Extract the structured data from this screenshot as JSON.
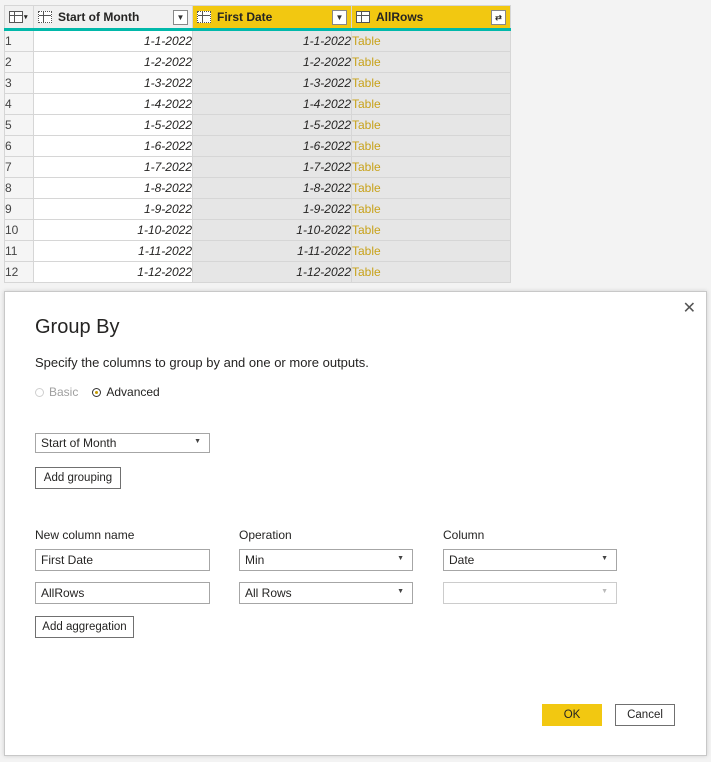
{
  "grid": {
    "columns": [
      {
        "label": "Start of Month",
        "icon": "calendar-grid-icon",
        "control": "filter-dropdown"
      },
      {
        "label": "First Date",
        "icon": "calendar-grid-icon",
        "control": "filter-dropdown",
        "selected": true
      },
      {
        "label": "AllRows",
        "icon": "table-icon",
        "control": "expand-icon",
        "selected": true
      }
    ],
    "rows": [
      {
        "n": "1",
        "a": "1-1-2022",
        "b": "1-1-2022",
        "c": "Table"
      },
      {
        "n": "2",
        "a": "1-2-2022",
        "b": "1-2-2022",
        "c": "Table"
      },
      {
        "n": "3",
        "a": "1-3-2022",
        "b": "1-3-2022",
        "c": "Table"
      },
      {
        "n": "4",
        "a": "1-4-2022",
        "b": "1-4-2022",
        "c": "Table"
      },
      {
        "n": "5",
        "a": "1-5-2022",
        "b": "1-5-2022",
        "c": "Table"
      },
      {
        "n": "6",
        "a": "1-6-2022",
        "b": "1-6-2022",
        "c": "Table"
      },
      {
        "n": "7",
        "a": "1-7-2022",
        "b": "1-7-2022",
        "c": "Table"
      },
      {
        "n": "8",
        "a": "1-8-2022",
        "b": "1-8-2022",
        "c": "Table"
      },
      {
        "n": "9",
        "a": "1-9-2022",
        "b": "1-9-2022",
        "c": "Table"
      },
      {
        "n": "10",
        "a": "1-10-2022",
        "b": "1-10-2022",
        "c": "Table"
      },
      {
        "n": "11",
        "a": "1-11-2022",
        "b": "1-11-2022",
        "c": "Table"
      },
      {
        "n": "12",
        "a": "1-12-2022",
        "b": "1-12-2022",
        "c": "Table"
      }
    ]
  },
  "dialog": {
    "title": "Group By",
    "close_icon": "close-icon",
    "description": "Specify the columns to group by and one or more outputs.",
    "mode_basic": "Basic",
    "mode_advanced": "Advanced",
    "selected_mode": "Advanced",
    "grouping_column": "Start of Month",
    "add_grouping_label": "Add grouping",
    "headers": {
      "new_column_name": "New column name",
      "operation": "Operation",
      "column": "Column"
    },
    "aggregations": [
      {
        "name": "First Date",
        "operation": "Min",
        "column": "Date"
      },
      {
        "name": "AllRows",
        "operation": "All Rows",
        "column": ""
      }
    ],
    "add_aggregation_label": "Add aggregation",
    "ok_label": "OK",
    "cancel_label": "Cancel"
  },
  "colors": {
    "accent": "#f2c811",
    "header_underline": "#01b8aa",
    "table_link": "#c8a21a"
  }
}
